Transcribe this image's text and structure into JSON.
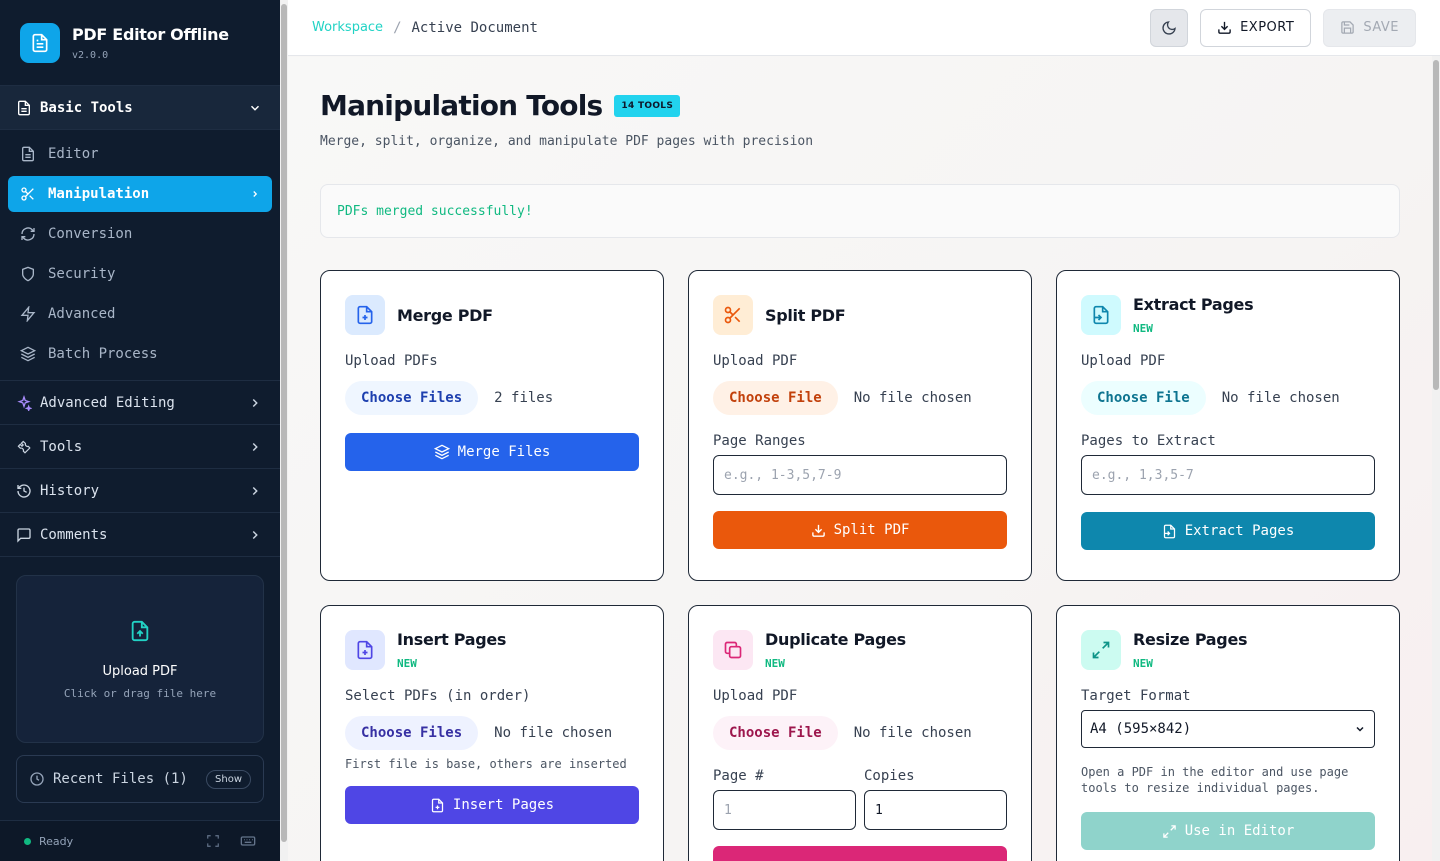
{
  "brand": {
    "title": "PDF Editor Offline",
    "version": "v2.0.0"
  },
  "sidebar": {
    "basic_section": "Basic Tools",
    "items": [
      {
        "label": "Editor"
      },
      {
        "label": "Manipulation"
      },
      {
        "label": "Conversion"
      },
      {
        "label": "Security"
      },
      {
        "label": "Advanced"
      },
      {
        "label": "Batch Process"
      }
    ],
    "sections": [
      {
        "label": "Advanced Editing"
      },
      {
        "label": "Tools"
      },
      {
        "label": "History"
      },
      {
        "label": "Comments"
      }
    ],
    "upload": {
      "title": "Upload PDF",
      "subtitle": "Click or drag file here"
    },
    "recent": {
      "label": "Recent Files (1)",
      "show": "Show"
    },
    "status": "Ready"
  },
  "topbar": {
    "breadcrumb_root": "Workspace",
    "breadcrumb_sep": "/",
    "breadcrumb_current": "Active Document",
    "export_label": "EXPORT",
    "save_label": "SAVE"
  },
  "main": {
    "title": "Manipulation Tools",
    "badge": "14 TOOLS",
    "subtitle": "Merge, split, organize, and manipulate PDF pages with precision",
    "alert": "PDFs merged successfully!"
  },
  "cards": {
    "merge": {
      "title": "Merge PDF",
      "upload_label": "Upload PDFs",
      "choose": "Choose Files",
      "status": "2 files",
      "action": "Merge Files"
    },
    "split": {
      "title": "Split PDF",
      "upload_label": "Upload PDF",
      "choose": "Choose File",
      "status": "No file chosen",
      "range_label": "Page Ranges",
      "range_placeholder": "e.g., 1-3,5,7-9",
      "action": "Split PDF"
    },
    "extract": {
      "title": "Extract Pages",
      "tag": "NEW",
      "upload_label": "Upload PDF",
      "choose": "Choose File",
      "status": "No file chosen",
      "pages_label": "Pages to Extract",
      "pages_placeholder": "e.g., 1,3,5-7",
      "action": "Extract Pages"
    },
    "insert": {
      "title": "Insert Pages",
      "tag": "NEW",
      "upload_label": "Select PDFs (in order)",
      "choose": "Choose Files",
      "status": "No file chosen",
      "hint": "First file is base, others are inserted",
      "action": "Insert Pages"
    },
    "duplicate": {
      "title": "Duplicate Pages",
      "tag": "NEW",
      "upload_label": "Upload PDF",
      "choose": "Choose File",
      "status": "No file chosen",
      "page_label": "Page #",
      "page_placeholder": "1",
      "copies_label": "Copies",
      "copies_value": "1"
    },
    "resize": {
      "title": "Resize Pages",
      "tag": "NEW",
      "format_label": "Target Format",
      "format_value": "A4 (595×842)",
      "hint": "Open a PDF in the editor and use page tools to resize individual pages.",
      "action": "Use in Editor"
    }
  },
  "colors": {
    "accent": "#0ea5e9",
    "merge": "#2563eb",
    "split": "#ea580c",
    "extract": "#0e87ad",
    "insert": "#4f46e5",
    "duplicate": "#db2777",
    "resize": "#8fd3cb",
    "success": "#10b981"
  }
}
